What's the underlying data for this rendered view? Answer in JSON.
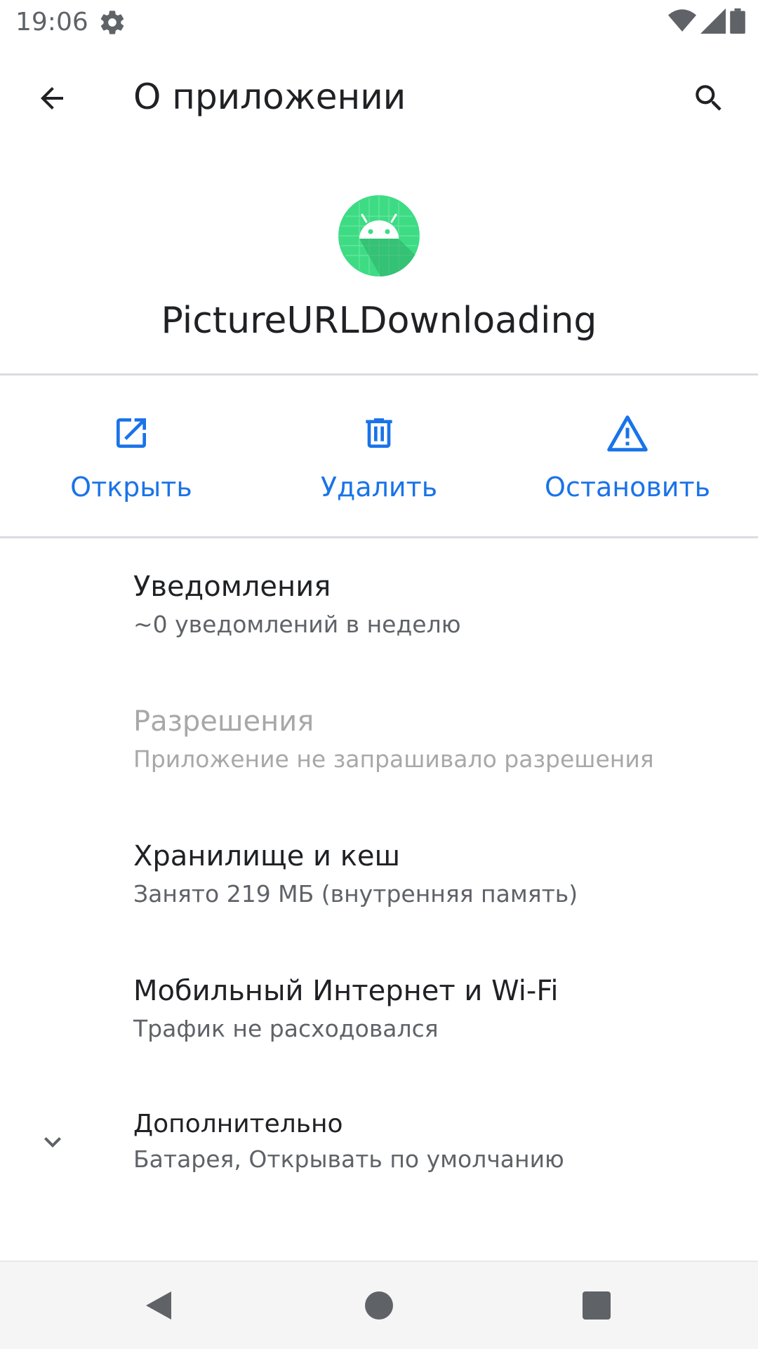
{
  "status_bar": {
    "time": "19:06"
  },
  "app_bar": {
    "title": "О приложении"
  },
  "app": {
    "name": "PictureURLDownloading"
  },
  "actions": [
    {
      "label": "Открыть",
      "icon": "open-external-icon"
    },
    {
      "label": "Удалить",
      "icon": "trash-icon"
    },
    {
      "label": "Остановить",
      "icon": "warning-icon"
    }
  ],
  "settings": {
    "notifications": {
      "title": "Уведомления",
      "subtitle": "~0 уведомлений в неделю"
    },
    "permissions": {
      "title": "Разрешения",
      "subtitle": "Приложение не запрашивало разрешения"
    },
    "storage": {
      "title": "Хранилище и кеш",
      "subtitle": "Занято 219 МБ (внутренняя память)"
    },
    "data": {
      "title": "Мобильный Интернет и Wi-Fi",
      "subtitle": "Трафик не расходовался"
    },
    "advanced": {
      "title": "Дополнительно",
      "subtitle": "Батарея, Открывать по умолчанию"
    }
  },
  "colors": {
    "accent": "#1a73e8",
    "icon_green": "#3ddc84"
  }
}
